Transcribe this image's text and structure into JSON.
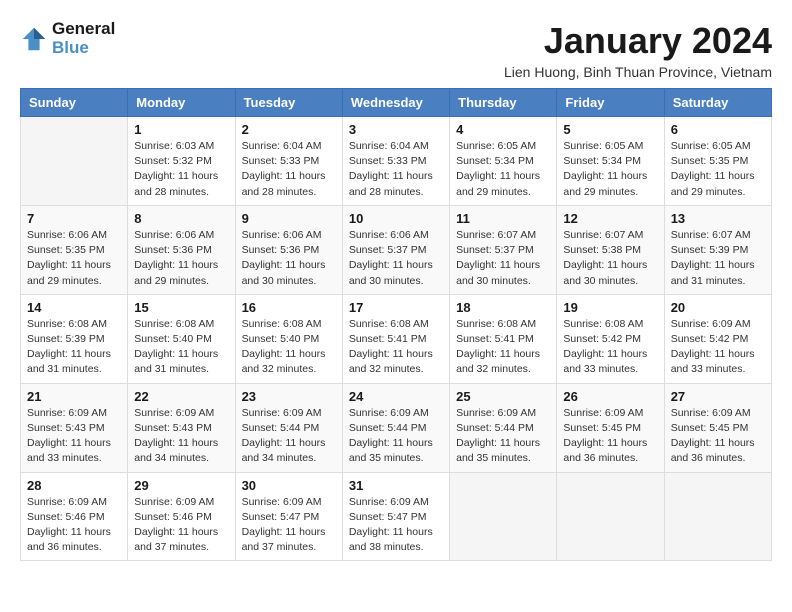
{
  "header": {
    "logo_line1": "General",
    "logo_line2": "Blue",
    "title": "January 2024",
    "location": "Lien Huong, Binh Thuan Province, Vietnam"
  },
  "days_of_week": [
    "Sunday",
    "Monday",
    "Tuesday",
    "Wednesday",
    "Thursday",
    "Friday",
    "Saturday"
  ],
  "weeks": [
    [
      {
        "day": "",
        "detail": ""
      },
      {
        "day": "1",
        "detail": "Sunrise: 6:03 AM\nSunset: 5:32 PM\nDaylight: 11 hours\nand 28 minutes."
      },
      {
        "day": "2",
        "detail": "Sunrise: 6:04 AM\nSunset: 5:33 PM\nDaylight: 11 hours\nand 28 minutes."
      },
      {
        "day": "3",
        "detail": "Sunrise: 6:04 AM\nSunset: 5:33 PM\nDaylight: 11 hours\nand 28 minutes."
      },
      {
        "day": "4",
        "detail": "Sunrise: 6:05 AM\nSunset: 5:34 PM\nDaylight: 11 hours\nand 29 minutes."
      },
      {
        "day": "5",
        "detail": "Sunrise: 6:05 AM\nSunset: 5:34 PM\nDaylight: 11 hours\nand 29 minutes."
      },
      {
        "day": "6",
        "detail": "Sunrise: 6:05 AM\nSunset: 5:35 PM\nDaylight: 11 hours\nand 29 minutes."
      }
    ],
    [
      {
        "day": "7",
        "detail": "Sunrise: 6:06 AM\nSunset: 5:35 PM\nDaylight: 11 hours\nand 29 minutes."
      },
      {
        "day": "8",
        "detail": "Sunrise: 6:06 AM\nSunset: 5:36 PM\nDaylight: 11 hours\nand 29 minutes."
      },
      {
        "day": "9",
        "detail": "Sunrise: 6:06 AM\nSunset: 5:36 PM\nDaylight: 11 hours\nand 30 minutes."
      },
      {
        "day": "10",
        "detail": "Sunrise: 6:06 AM\nSunset: 5:37 PM\nDaylight: 11 hours\nand 30 minutes."
      },
      {
        "day": "11",
        "detail": "Sunrise: 6:07 AM\nSunset: 5:37 PM\nDaylight: 11 hours\nand 30 minutes."
      },
      {
        "day": "12",
        "detail": "Sunrise: 6:07 AM\nSunset: 5:38 PM\nDaylight: 11 hours\nand 30 minutes."
      },
      {
        "day": "13",
        "detail": "Sunrise: 6:07 AM\nSunset: 5:39 PM\nDaylight: 11 hours\nand 31 minutes."
      }
    ],
    [
      {
        "day": "14",
        "detail": "Sunrise: 6:08 AM\nSunset: 5:39 PM\nDaylight: 11 hours\nand 31 minutes."
      },
      {
        "day": "15",
        "detail": "Sunrise: 6:08 AM\nSunset: 5:40 PM\nDaylight: 11 hours\nand 31 minutes."
      },
      {
        "day": "16",
        "detail": "Sunrise: 6:08 AM\nSunset: 5:40 PM\nDaylight: 11 hours\nand 32 minutes."
      },
      {
        "day": "17",
        "detail": "Sunrise: 6:08 AM\nSunset: 5:41 PM\nDaylight: 11 hours\nand 32 minutes."
      },
      {
        "day": "18",
        "detail": "Sunrise: 6:08 AM\nSunset: 5:41 PM\nDaylight: 11 hours\nand 32 minutes."
      },
      {
        "day": "19",
        "detail": "Sunrise: 6:08 AM\nSunset: 5:42 PM\nDaylight: 11 hours\nand 33 minutes."
      },
      {
        "day": "20",
        "detail": "Sunrise: 6:09 AM\nSunset: 5:42 PM\nDaylight: 11 hours\nand 33 minutes."
      }
    ],
    [
      {
        "day": "21",
        "detail": "Sunrise: 6:09 AM\nSunset: 5:43 PM\nDaylight: 11 hours\nand 33 minutes."
      },
      {
        "day": "22",
        "detail": "Sunrise: 6:09 AM\nSunset: 5:43 PM\nDaylight: 11 hours\nand 34 minutes."
      },
      {
        "day": "23",
        "detail": "Sunrise: 6:09 AM\nSunset: 5:44 PM\nDaylight: 11 hours\nand 34 minutes."
      },
      {
        "day": "24",
        "detail": "Sunrise: 6:09 AM\nSunset: 5:44 PM\nDaylight: 11 hours\nand 35 minutes."
      },
      {
        "day": "25",
        "detail": "Sunrise: 6:09 AM\nSunset: 5:44 PM\nDaylight: 11 hours\nand 35 minutes."
      },
      {
        "day": "26",
        "detail": "Sunrise: 6:09 AM\nSunset: 5:45 PM\nDaylight: 11 hours\nand 36 minutes."
      },
      {
        "day": "27",
        "detail": "Sunrise: 6:09 AM\nSunset: 5:45 PM\nDaylight: 11 hours\nand 36 minutes."
      }
    ],
    [
      {
        "day": "28",
        "detail": "Sunrise: 6:09 AM\nSunset: 5:46 PM\nDaylight: 11 hours\nand 36 minutes."
      },
      {
        "day": "29",
        "detail": "Sunrise: 6:09 AM\nSunset: 5:46 PM\nDaylight: 11 hours\nand 37 minutes."
      },
      {
        "day": "30",
        "detail": "Sunrise: 6:09 AM\nSunset: 5:47 PM\nDaylight: 11 hours\nand 37 minutes."
      },
      {
        "day": "31",
        "detail": "Sunrise: 6:09 AM\nSunset: 5:47 PM\nDaylight: 11 hours\nand 38 minutes."
      },
      {
        "day": "",
        "detail": ""
      },
      {
        "day": "",
        "detail": ""
      },
      {
        "day": "",
        "detail": ""
      }
    ]
  ]
}
